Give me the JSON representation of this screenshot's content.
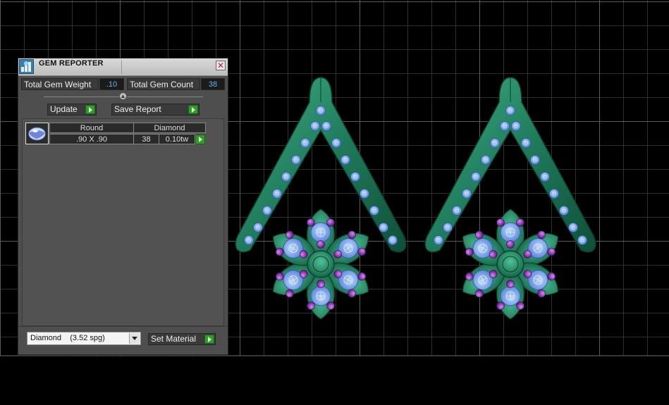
{
  "app": {
    "title": "GEM REPORTER"
  },
  "stats": {
    "weight_label": "Total Gem Weight",
    "weight_value": ".10",
    "count_label": "Total Gem Count",
    "count_value": "38"
  },
  "toolbar": {
    "update_label": "Update",
    "save_report_label": "Save Report"
  },
  "gem_list": {
    "rows": [
      {
        "shape": "Round",
        "material": "Diamond",
        "size": ".90 X .90",
        "count": "38",
        "weight": "0.10tw"
      }
    ]
  },
  "material_select": {
    "value": "Diamond    (3.52 spg)"
  },
  "set_material": {
    "label": "Set Material"
  },
  "icons": {
    "app": "gem-reporter-icon",
    "close": "close-icon",
    "go": "play-arrow-icon",
    "gem": "round-gem-icon",
    "dropdown": "chevron-down-icon"
  },
  "colors": {
    "metal": "#1e7a5a",
    "stone": "#79a9e8",
    "accent_stone": "#8a2bb0",
    "go_button": "#2f9d2c",
    "value_text": "#63b4ea"
  }
}
